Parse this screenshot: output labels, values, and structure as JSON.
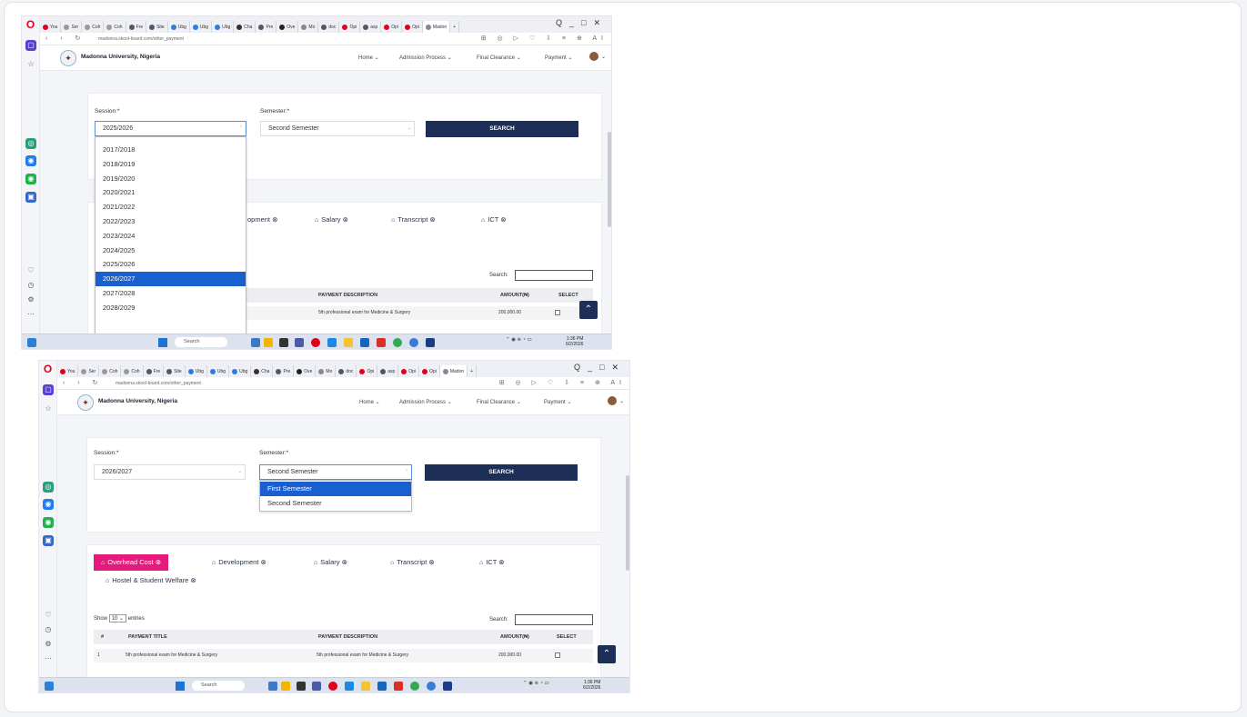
{
  "browser": {
    "tabs": [
      "You",
      "Ser",
      "Coh",
      "Coh",
      "Fre",
      "Site",
      "Ubg",
      "Ubg",
      "Ubg",
      "Cha",
      "Pre",
      "Ove",
      "Mo",
      "doc",
      "Opi",
      "asp",
      "Opi",
      "Opi",
      "Madon"
    ],
    "new_tab": "+",
    "url": "madonna.skool-board.com/other_payment",
    "ai_label": "AI",
    "window_controls": [
      "Q",
      "_",
      "□",
      "✕"
    ]
  },
  "site": {
    "name": "Madonna University, Nigeria",
    "menu": [
      "Home",
      "Admission Process",
      "Final Clearance",
      "Payment"
    ]
  },
  "form": {
    "session_label": "Session:",
    "semester_label": "Semester:",
    "required_mark": "*",
    "search_button": "SEARCH"
  },
  "shot1": {
    "session_value": "2025/2026",
    "semester_value": "Second Semester",
    "session_options": [
      "2017/2018",
      "2018/2019",
      "2019/2020",
      "2020/2021",
      "2021/2022",
      "2022/2023",
      "2023/2024",
      "2024/2025",
      "2025/2026",
      "2026/2027",
      "2027/2028",
      "2028/2029"
    ],
    "highlighted_option": "2026/2027",
    "visible_categories": [
      "opment",
      "Salary",
      "Transcript",
      "ICT"
    ]
  },
  "shot2": {
    "session_value": "2026/2027",
    "semester_value": "Second Semester",
    "semester_options": [
      "First Semester",
      "Second Semester"
    ],
    "highlighted_option": "First Semester"
  },
  "categories": [
    "Overhead Cost",
    "Development",
    "Salary",
    "Transcript",
    "ICT",
    "Hostel & Student Welfare"
  ],
  "table": {
    "show_label": "Show",
    "entries_value": "10",
    "entries_label": "entries",
    "search_label": "Search:",
    "headers": [
      "#",
      "PAYMENT TITLE",
      "PAYMENT DESCRIPTION",
      "AMOUNT(₦)",
      "SELECT"
    ],
    "rows": [
      {
        "num": "1",
        "title": "5th professional exam for Medicine & Surgery",
        "description": "5th professional exam for Medicine & Surgery",
        "amount": "200,000.00"
      }
    ]
  },
  "taskbar": {
    "search": "Search",
    "time": "1:36 PM",
    "date": "6/2/2026"
  },
  "colors": {
    "accent": "#e6197c",
    "primary": "#1d2f57",
    "highlight": "#1a5fd0"
  }
}
